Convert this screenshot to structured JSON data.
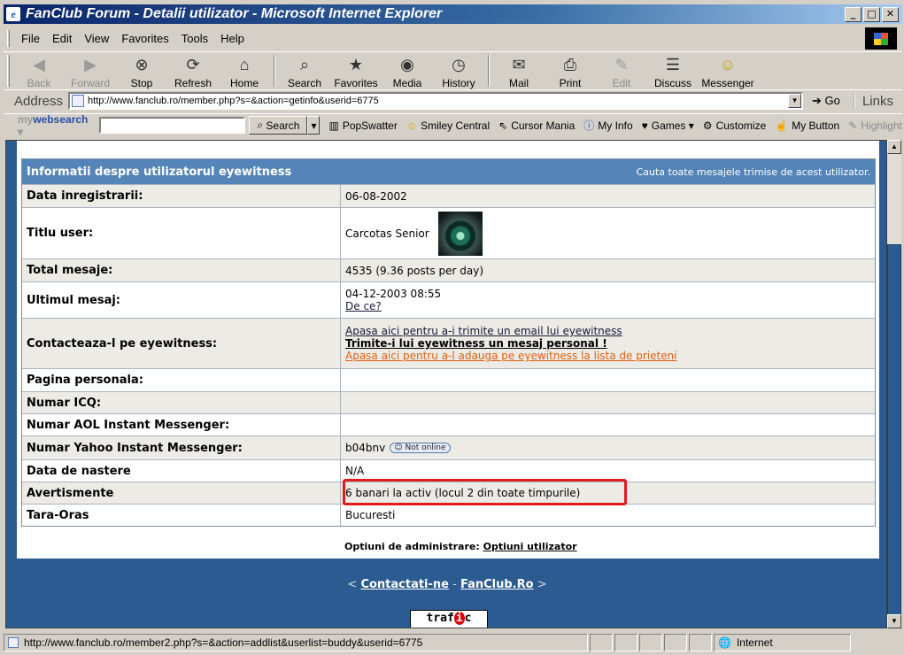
{
  "window": {
    "title": "FanClub Forum - Detalii utilizator - Microsoft Internet Explorer",
    "min": "_",
    "max": "□",
    "close": "✕"
  },
  "menu": [
    "File",
    "Edit",
    "View",
    "Favorites",
    "Tools",
    "Help"
  ],
  "toolbar": {
    "back": "Back",
    "forward": "Forward",
    "stop": "Stop",
    "refresh": "Refresh",
    "home": "Home",
    "search": "Search",
    "favorites": "Favorites",
    "media": "Media",
    "history": "History",
    "mail": "Mail",
    "print": "Print",
    "edit": "Edit",
    "discuss": "Discuss",
    "messenger": "Messenger"
  },
  "address": {
    "label": "Address",
    "url": "http://www.fanclub.ro/member.php?s=&action=getinfo&userid=6775",
    "go": "Go",
    "links": "Links"
  },
  "searchbar": {
    "brand_prefix": "my",
    "brand": "websearch",
    "search_btn": "Search",
    "popswatter": "PopSwatter",
    "smiley": "Smiley Central",
    "cursor": "Cursor Mania",
    "myinfo": "My Info",
    "games": "Games",
    "customize": "Customize",
    "mybutton": "My Button",
    "highlight": "Highlight"
  },
  "profile": {
    "header_title": "Informatii despre utilizatorul eyewitness",
    "header_link": "Cauta toate mesajele trimise de acest utilizator.",
    "rows": [
      {
        "k": "Data inregistrarii:",
        "v": "06-08-2002"
      },
      {
        "k": "Titlu user:",
        "v": "Carcotas Senior"
      },
      {
        "k": "Total mesaje:",
        "v": "4535 (9.36 posts per day)"
      },
      {
        "k": "Ultimul mesaj:",
        "v": "04-12-2003 08:55",
        "v2": "De ce?"
      },
      {
        "k": "Contacteaza-l pe eyewitness:",
        "v": "Apasa aici pentru a-i trimite un email lui eyewitness",
        "v2": "Trimite-i lui eyewitness un mesaj personal !",
        "v3": "Apasa aici pentru a-l adauga pe eyewitness la lista de prieteni"
      },
      {
        "k": "Pagina personala:",
        "v": ""
      },
      {
        "k": "Numar ICQ:",
        "v": ""
      },
      {
        "k": "Numar AOL Instant Messenger:",
        "v": ""
      },
      {
        "k": "Numar Yahoo Instant Messenger:",
        "v": "b04bnv",
        "badge": "Not online"
      },
      {
        "k": "Data de nastere",
        "v": "N/A"
      },
      {
        "k": "Avertismente",
        "v": "6 banari la activ (locul 2 din toate timpurile)"
      },
      {
        "k": "Tara-Oras",
        "v": "Bucuresti"
      }
    ],
    "admin_label": "Optiuni de administrare:",
    "admin_link": "Optiuni utilizator"
  },
  "footer": {
    "open": "<",
    "contact": "Contactati-ne",
    "dash": "-",
    "site": "FanClub.Ro",
    "close": ">",
    "trafic": "trafic"
  },
  "status": {
    "url": "http://www.fanclub.ro/member2.php?s=&action=addlist&userlist=buddy&userid=6775",
    "zone": "Internet"
  }
}
